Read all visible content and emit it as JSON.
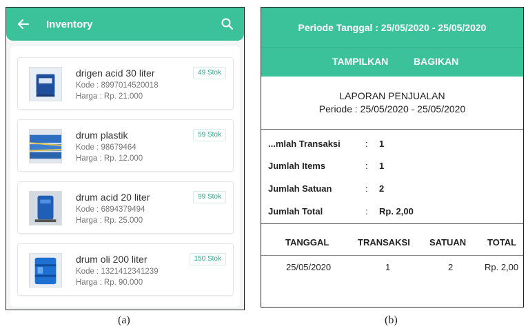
{
  "inventory": {
    "title": "Inventory",
    "back_icon": "arrow-left-icon",
    "search_icon": "search-icon",
    "accent_color": "#3cc29a",
    "items": [
      {
        "name": "drigen acid 30 liter",
        "code": "Kode : 8997014520018",
        "price": "Harga : Rp. 21.000",
        "stock": "49 Stok"
      },
      {
        "name": "drum plastik",
        "code": "Kode : 98679464",
        "price": "Harga : Rp. 12.000",
        "stock": "59 Stok"
      },
      {
        "name": "drum acid 20 liter",
        "code": "Kode : 6894379494",
        "price": "Harga : Rp. 25.000",
        "stock": "99 Stok"
      },
      {
        "name": "drum oli 200 liter",
        "code": "Kode : 1321412341239",
        "price": "Harga : Rp. 90.000",
        "stock": "150 Stok"
      }
    ]
  },
  "report": {
    "period_header": "Periode Tanggal : 25/05/2020 - 25/05/2020",
    "show_button": "TAMPILKAN",
    "share_button": "BAGIKAN",
    "title": "LAPORAN PENJUALAN",
    "period": "Periode : 25/05/2020 - 25/05/2020",
    "summary": [
      {
        "label": "...mlah Transaksi",
        "colon": ":",
        "value": "1"
      },
      {
        "label": "Jumlah Items",
        "colon": ":",
        "value": "1"
      },
      {
        "label": "Jumlah Satuan",
        "colon": ":",
        "value": "2"
      },
      {
        "label": "Jumlah Total",
        "colon": ":",
        "value": "Rp. 2,00"
      }
    ],
    "columns": [
      "TANGGAL",
      "TRANSAKSI",
      "SATUAN",
      "TOTAL"
    ],
    "rows": [
      [
        "25/05/2020",
        "1",
        "2",
        "Rp. 2,00"
      ]
    ]
  },
  "captions": {
    "a": "(a)",
    "b": "(b)"
  }
}
